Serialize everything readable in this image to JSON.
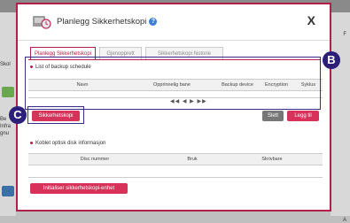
{
  "background": {
    "left_labels": [
      "Skol",
      "Be",
      "Infra",
      "gnu"
    ],
    "right_labels": [
      "F",
      "A"
    ]
  },
  "dialog": {
    "title": "Planlegg Sikkerhetskopi",
    "help_label": "?",
    "close_label": "X",
    "tabs": [
      {
        "label": "Planlegg Sikkerhetskopi"
      },
      {
        "label": "Gjenopprett"
      },
      {
        "label": "Sikkerhetskopi historie"
      }
    ],
    "backup_section": {
      "title": "List of backup schedule",
      "columns": [
        "Navn",
        "Opprinnelig bane",
        "Backup device",
        "Encryption",
        "Syklus"
      ],
      "pager": "◀◀  ◀  ▶  ▶▶"
    },
    "buttons": {
      "backup": "Sikkerhetskopi",
      "delete": "Slett",
      "add": "Legg til",
      "init": "Initialiser sikkerhetskopi-enhet"
    },
    "disk_section": {
      "title": "Koblet optisk disk informasjon",
      "columns": [
        "Disc nummer",
        "Bruk",
        "Skrivbare"
      ]
    }
  },
  "annotations": {
    "b_label": "B",
    "c_label": "C"
  },
  "colors": {
    "accent": "#b02048",
    "button": "#d6325a",
    "highlight": "#2c1f7a"
  }
}
